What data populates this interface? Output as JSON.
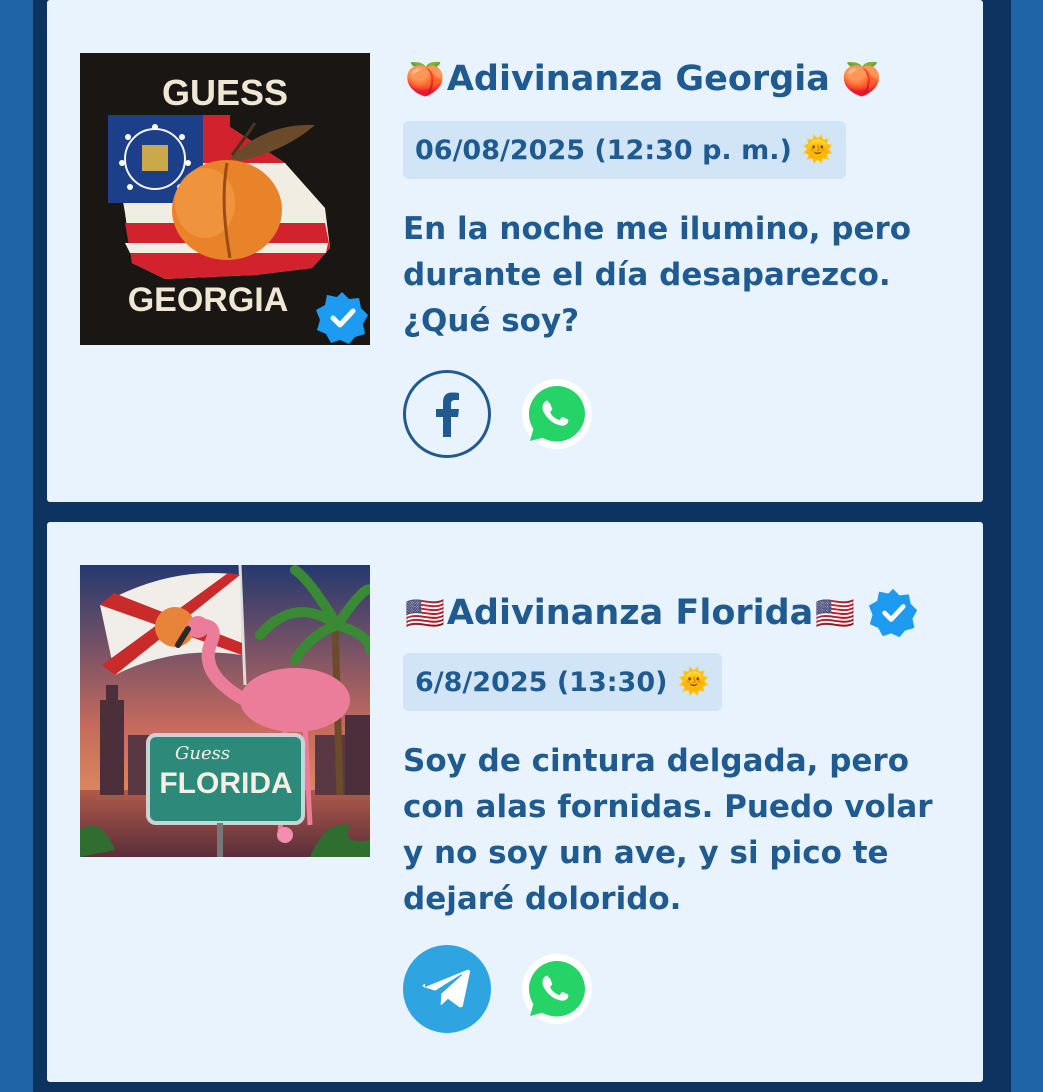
{
  "cards": [
    {
      "image_alt": "Guess Georgia",
      "image_text_top": "GUESS",
      "image_text_bottom": "GEORGIA",
      "title_prefix_emoji": "🍑",
      "title": "Adivinanza Georgia",
      "title_suffix_emoji": "🍑",
      "date": "06/08/2025 (12:30 p. m.)",
      "date_emoji": "🌞",
      "riddle": "En la noche me ilumino, pero durante el día desaparezco. ¿Qué soy?",
      "share_buttons": [
        "facebook-icon",
        "whatsapp-icon"
      ]
    },
    {
      "image_alt": "Guess Florida",
      "image_text_top": "Guess",
      "image_text_bottom": "FLORIDA",
      "title_prefix_emoji": "🇺🇸",
      "title": "Adivinanza Florida",
      "title_suffix_emoji": "🇺🇸",
      "date": "6/8/2025 (13:30)",
      "date_emoji": "🌞",
      "riddle": "Soy de cintura delgada, pero con alas fornidas. Puedo volar y no soy un ave, y si pico te dejaré dolorido.",
      "share_buttons": [
        "telegram-icon",
        "whatsapp-icon"
      ]
    }
  ],
  "colors": {
    "page_bg": "#1f64a6",
    "frame": "#0d3460",
    "card_bg": "#e8f3fd",
    "text": "#1f5a91",
    "date_bg": "#d1e5f7",
    "whatsapp": "#25d366",
    "telegram": "#2ea4e0",
    "verified": "#1d9bf0"
  }
}
